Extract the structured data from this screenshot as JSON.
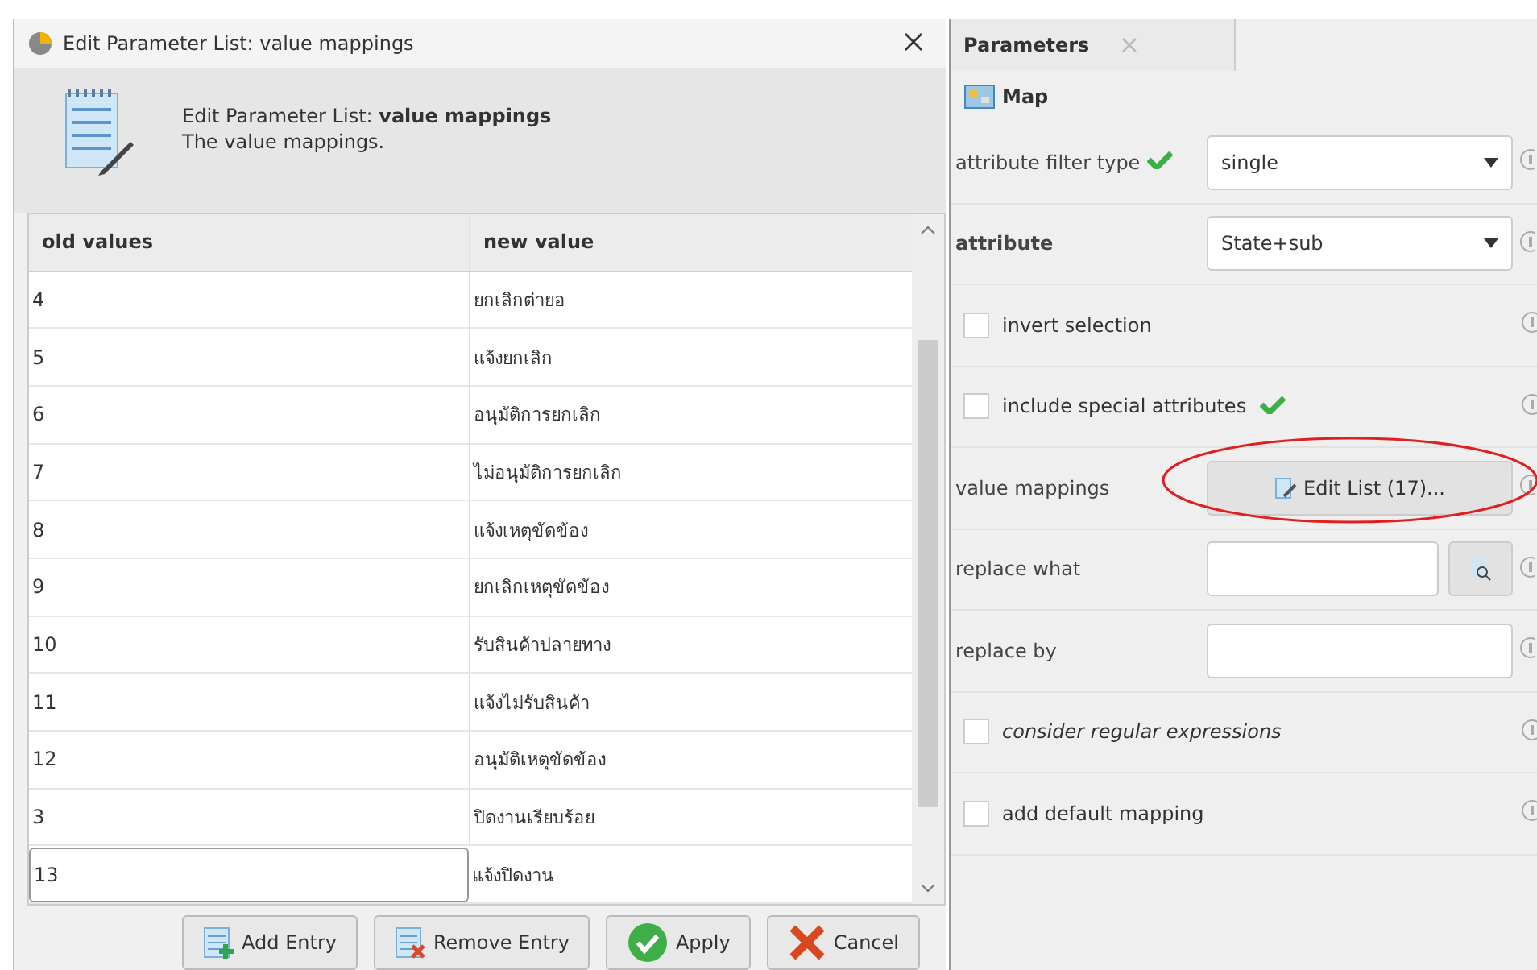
{
  "dialog": {
    "title": "Edit Parameter List: value mappings",
    "header_title": "Edit Parameter List: **value mappings**",
    "header_description": "The value mappings.",
    "table": {
      "columns": [
        "old values",
        "new value"
      ],
      "rows": [
        {
          "old": "4",
          "new": "ยกเลิกต่ายอ",
          "editing": false
        },
        {
          "old": "5",
          "new": "แจ้งยกเลิก",
          "editing": false
        },
        {
          "old": "6",
          "new": "อนุมัติการยกเลิก",
          "editing": false
        },
        {
          "old": "7",
          "new": "ไม่อนุมัติการยกเลิก",
          "editing": false
        },
        {
          "old": "8",
          "new": "แจ้งเหตุขัดข้อง",
          "editing": false
        },
        {
          "old": "9",
          "new": "ยกเลิกเหตุขัดข้อง",
          "editing": false
        },
        {
          "old": "10",
          "new": "รับสินค้าปลายทาง",
          "editing": false
        },
        {
          "old": "11",
          "new": "แจ้งไม่รับสินค้า",
          "editing": false
        },
        {
          "old": "12",
          "new": "อนุมัติเหตุขัดข้อง",
          "editing": false
        },
        {
          "old": "3",
          "new": "ปิดงานเรียบร้อย",
          "editing": false
        },
        {
          "old": "13",
          "new": "แจ้งปิดงาน",
          "editing": true
        }
      ]
    },
    "buttons": [
      {
        "kind": "add",
        "label": "Add Entry"
      },
      {
        "kind": "remove",
        "label": "Remove Entry"
      },
      {
        "kind": "apply",
        "label": "Apply"
      },
      {
        "kind": "cancel",
        "label": "Cancel"
      }
    ]
  },
  "parameters": {
    "tab": "Parameters",
    "operator": "Map",
    "rows": [
      {
        "kind": "select",
        "label": "attribute filter type",
        "verified": true,
        "bold": false,
        "value": "single"
      },
      {
        "kind": "select",
        "label": "attribute",
        "verified": false,
        "bold": true,
        "value": "State+sub"
      },
      {
        "kind": "checkbox",
        "label": "invert selection",
        "verified": false,
        "checked": false,
        "italic": false
      },
      {
        "kind": "checkbox",
        "label": "include special attributes",
        "verified": true,
        "checked": false,
        "italic": false
      },
      {
        "kind": "button",
        "label": "value mappings",
        "verified": false,
        "bold": false,
        "button": "Edit List (17)...",
        "highlighted": true
      },
      {
        "kind": "text",
        "label": "replace what",
        "verified": false,
        "bold": false,
        "browse": true
      },
      {
        "kind": "text",
        "label": "replace by",
        "verified": false,
        "bold": false,
        "browse": false
      },
      {
        "kind": "checkbox",
        "label": "consider regular expressions",
        "verified": false,
        "checked": false,
        "italic": true
      },
      {
        "kind": "checkbox",
        "label": "add default mapping",
        "verified": false,
        "checked": false,
        "italic": false
      }
    ]
  }
}
